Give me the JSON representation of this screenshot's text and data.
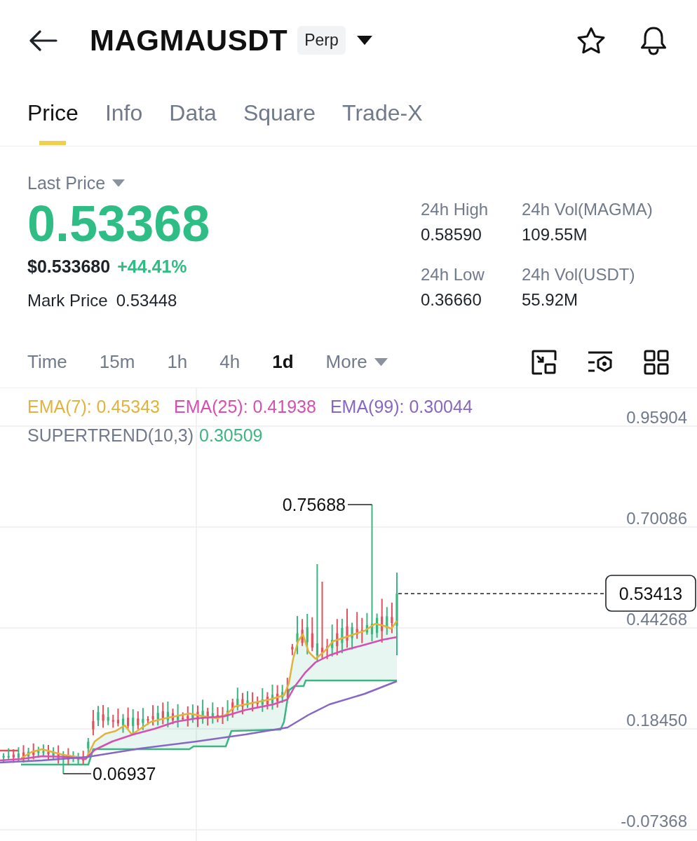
{
  "header": {
    "symbol": "MAGMAUSDT",
    "badge": "Perp"
  },
  "tabs": [
    {
      "label": "Price",
      "selected": true
    },
    {
      "label": "Info",
      "selected": false
    },
    {
      "label": "Data",
      "selected": false
    },
    {
      "label": "Square",
      "selected": false
    },
    {
      "label": "Trade-X",
      "selected": false
    }
  ],
  "last_price": {
    "label": "Last Price",
    "value": "0.53368",
    "usd_value": "$0.533680",
    "change": "+44.41%",
    "mark_label": "Mark Price",
    "mark_value": "0.53448"
  },
  "stats": [
    {
      "label": "24h High",
      "value": "0.58590"
    },
    {
      "label": "24h Vol(MAGMA)",
      "value": "109.55M"
    },
    {
      "label": "24h Low",
      "value": "0.36660"
    },
    {
      "label": "24h Vol(USDT)",
      "value": "55.92M"
    }
  ],
  "intervals": [
    {
      "kind": "option",
      "label": "Time",
      "selected": false
    },
    {
      "kind": "option",
      "label": "15m",
      "selected": false
    },
    {
      "kind": "option",
      "label": "1h",
      "selected": false
    },
    {
      "kind": "option",
      "label": "4h",
      "selected": false
    },
    {
      "kind": "option",
      "label": "1d",
      "selected": true
    },
    {
      "kind": "menu",
      "label": "More",
      "selected": false
    }
  ],
  "chart": {
    "indicators": [
      {
        "kind": "ema",
        "label": "EMA(7): 0.45343",
        "color": "#e2b33c"
      },
      {
        "kind": "ema",
        "label": "EMA(25): 0.41938",
        "color": "#d74fb0"
      },
      {
        "kind": "ema",
        "label": "EMA(99): 0.30044",
        "color": "#8767c3"
      },
      {
        "kind": "supertrend",
        "label": "SUPERTREND(10,3)",
        "value": "0.30509",
        "color": "#3db583"
      }
    ],
    "price_axis": [
      "0.95904",
      "0.70086",
      "0.44268",
      "0.18450",
      "-0.07368"
    ],
    "high_marker": "0.75688",
    "low_marker": "0.06937",
    "last_price_tag": "0.53413"
  }
}
